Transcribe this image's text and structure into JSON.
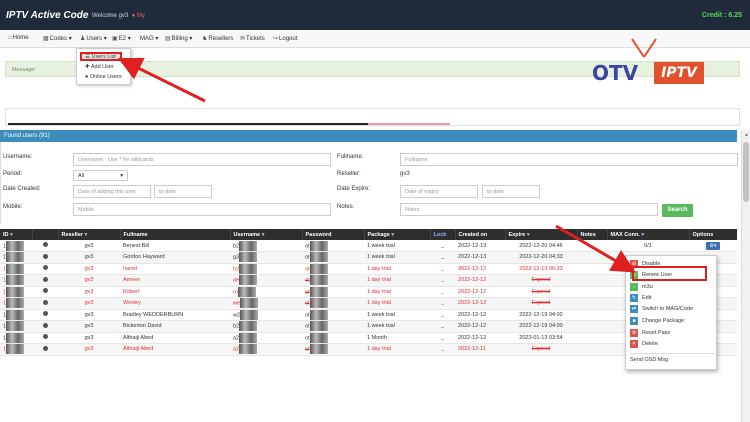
{
  "header": {
    "brand": "IPTV Active Code",
    "welcome": "Welcome gv3",
    "my_link": "My",
    "credit": "Credit : 6.25"
  },
  "nav": {
    "items": [
      {
        "label": "Home",
        "icon": "home-icon"
      },
      {
        "label": "Codes",
        "icon": "grid-icon"
      },
      {
        "label": "Users",
        "icon": "user-icon"
      },
      {
        "label": "E2",
        "icon": "tv-icon"
      },
      {
        "label": "MAG",
        "icon": "mag-icon"
      },
      {
        "label": "Billing",
        "icon": "billing-icon"
      },
      {
        "label": "Resellers",
        "icon": "resellers-icon"
      },
      {
        "label": "Tickets",
        "icon": "ticket-icon"
      },
      {
        "label": "Logout",
        "icon": "logout-icon"
      }
    ],
    "users_menu": [
      "Users List",
      "Add User",
      "Online Users"
    ]
  },
  "message": {
    "label": "Message:"
  },
  "logo": {
    "otv": "OTV",
    "iptv": "IPTV"
  },
  "panel": {
    "title": "Found users (91)"
  },
  "search": {
    "username_label": "Username:",
    "username_placeholder": "Username : Use * for wildcards",
    "fullname_label": "Fullname:",
    "fullname_placeholder": "Fullname",
    "period_label": "Period:",
    "period_value": "All",
    "reseller_label": "Reseller:",
    "reseller_value": "gv3",
    "created_label": "Date Created:",
    "created_from_placeholder": "Date of adding this user",
    "created_to_placeholder": "to date",
    "expire_label": "Date Expire:",
    "expire_from_placeholder": "Date of expiry",
    "expire_to_placeholder": "to date",
    "mobile_label": "Mobile:",
    "mobile_placeholder": "Mobile",
    "notes_label": "Notes:",
    "notes_placeholder": "Notes",
    "button": "Search"
  },
  "table": {
    "headers": [
      "ID",
      "",
      "Reseller",
      "Fullname",
      "Username",
      "Password",
      "Package",
      "Lock",
      "Created on",
      "Expire",
      "Notes",
      "MAX Conn.",
      "Options"
    ],
    "rows": [
      {
        "id": "1",
        "reseller": "gv3",
        "fullname": "Benest Bill",
        "username": "b2",
        "password": "ot",
        "package": "1 week trial",
        "lock": "_",
        "created": "2022-12-13",
        "expire": "2022-12-20 04:46",
        "conn": "0/1",
        "red": false,
        "expired": false
      },
      {
        "id": "1",
        "reseller": "gv3",
        "fullname": "Gordon Hayward",
        "username": "g3",
        "password": "ot",
        "package": "1 week trial",
        "lock": "_",
        "created": "2022-12-13",
        "expire": "2022-12-20 04:33",
        "conn": "",
        "red": false,
        "expired": false
      },
      {
        "id": "1",
        "reseller": "gv3",
        "fullname": "hared",
        "username": "h2",
        "password": "ot",
        "package": "1 day trial",
        "lock": "_",
        "created": "2022-12-12",
        "expire": "2022-12-13 06:33",
        "conn": "",
        "red": true,
        "expired": false
      },
      {
        "id": "1",
        "reseller": "gv3",
        "fullname": "Ameen",
        "username": "de",
        "password": "ot",
        "package": "1 day trial",
        "lock": "_",
        "created": "2022-12-12",
        "expire": "Expired",
        "conn": "",
        "red": true,
        "expired": true
      },
      {
        "id": "1",
        "reseller": "gv3",
        "fullname": "Robert",
        "username": "ro",
        "password": "ot",
        "package": "1 day trial",
        "lock": "_",
        "created": "2022-12-12",
        "expire": "Expired",
        "conn": "",
        "red": true,
        "expired": true
      },
      {
        "id": "1",
        "reseller": "gv3",
        "fullname": "Wesley",
        "username": "we",
        "password": "ot",
        "package": "1 day trial",
        "lock": "_",
        "created": "2022-12-12",
        "expire": "Expired",
        "conn": "",
        "red": true,
        "expired": true
      },
      {
        "id": "1",
        "reseller": "gv3",
        "fullname": "Bradley WEDDERBURN",
        "username": "w2",
        "password": "ot",
        "package": "1 week trial",
        "lock": "_",
        "created": "2022-12-12",
        "expire": "2022-12-19 04:02",
        "conn": "",
        "red": false,
        "expired": false
      },
      {
        "id": "1",
        "reseller": "gv3",
        "fullname": "Bickerton David",
        "username": "b2",
        "password": "ot",
        "package": "1 week trial",
        "lock": "_",
        "created": "2022-12-12",
        "expire": "2022-12-19 04:00",
        "conn": "",
        "red": false,
        "expired": false
      },
      {
        "id": "1",
        "reseller": "gv3",
        "fullname": "Althaiji Abed",
        "username": "a2",
        "password": "ot",
        "package": "1 Month",
        "lock": "_",
        "created": "2022-12-12",
        "expire": "2023-01-13 03:54",
        "conn": "",
        "red": false,
        "expired": false
      },
      {
        "id": "1",
        "reseller": "gv3",
        "fullname": "Althaiji Abed",
        "username": "a2",
        "password": "ot",
        "package": "1 day trial",
        "lock": "_",
        "created": "2022-12-11",
        "expire": "Expired",
        "conn": "",
        "red": true,
        "expired": true
      }
    ]
  },
  "action_menu": [
    {
      "label": "Disable",
      "icon": "disable-icon",
      "color": "#d9534f"
    },
    {
      "label": "Renew User",
      "icon": "renew-icon",
      "color": "#5cb85c"
    },
    {
      "label": "m3u",
      "icon": "download-icon",
      "color": "#5cb85c"
    },
    {
      "label": "Edit",
      "icon": "edit-icon",
      "color": "#3c8dbc"
    },
    {
      "label": "Switch to MAG/Code",
      "icon": "switch-icon",
      "color": "#3c8dbc"
    },
    {
      "label": "Change Package",
      "icon": "package-icon",
      "color": "#3c8dbc"
    },
    {
      "label": "Reset Pass",
      "icon": "reset-icon",
      "color": "#d9534f"
    },
    {
      "label": "Delete",
      "icon": "delete-icon",
      "color": "#d9534f"
    },
    {
      "label": "Send OSD Msg",
      "icon": "",
      "color": ""
    }
  ]
}
